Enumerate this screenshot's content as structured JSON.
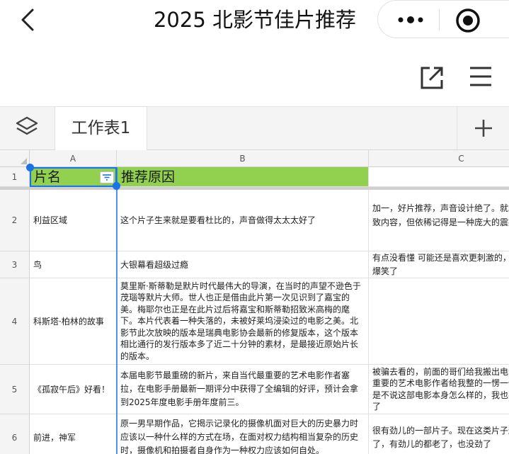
{
  "window": {
    "title": "2025 北影节佳片推荐",
    "back_icon": "chevron-left-icon",
    "more_icon": "more-dots-icon",
    "close_icon": "target-circle-icon"
  },
  "toolbar": {
    "share_icon": "share-external-icon",
    "menu_icon": "hamburger-menu-icon"
  },
  "sheets": {
    "layers_icon": "layers-icon",
    "active_tab": "工作表1",
    "add_icon": "plus-icon"
  },
  "grid": {
    "columns": [
      "A",
      "B",
      "C"
    ],
    "header_row": {
      "row": "1",
      "a": "片名",
      "b": "推荐原因",
      "c": ""
    },
    "header_fill": "#92d050",
    "rows": [
      {
        "row": "2",
        "a": "利益区域",
        "b": "这个片子生来就是要看杜比的，声音做得太太太好了",
        "c": "加一，好片推荐，声音设计绝了。就算忘记大致内容，但依稀记得是一种庞大的震撼"
      },
      {
        "row": "3",
        "a": "鸟",
        "b": "大银幕看超级过瘾",
        "c": "有点没看懂 可能还是喜欢更刺激的，但卫衣很爆笑了"
      },
      {
        "row": "4",
        "a": "科斯塔·柏林的故事",
        "b": "莫里斯·斯蒂勒是默片时代最伟大的导演，在当时的声望不逊色于茂瑙等默片大师。世人也正是借由此片第一次见识到了嘉宝的美。梅耶尔也正是在此片过后将嘉宝和斯蒂勒招致米高梅的麾下。本片代表着一种失落的，未被好莱坞浸染过的电影之美。北影节此次放映的版本是瑞典电影协会最新的修复版本，这个版本相比通行的发行版本多了近二十分钟的素材，是最接近原始片长的版本。",
        "c": ""
      },
      {
        "row": "5",
        "a": "《孤寂午后》好看！",
        "b": "本届电影节最重磅的新片，来自当代最重要的艺术电影作者塞拉，在电影手册最新一期评分中获得了全编辑的好评，预计会拿到2025年度电影手册年度前三。",
        "c": "被骗去看的，前面的哥们给我搬出电影节和最重要的艺术电影作者给我整的一愣一愣的，就是不说这部电影本身怎么样的，我也不会相信了"
      },
      {
        "row": "6",
        "a": "前进，神军",
        "b": "原一男早期作品，它揭示记录化的摄像机面对巨大的历史暴力时应该以一种什么样的方式在场，在面对权力结构相当复杂的历史时，摄像机和拍摄者自身作为一种权力应该如何自处。",
        "c": "很有劲儿的一部片子。现在这类片子越来越少了，有劲儿的都老了，也没劲了"
      }
    ]
  }
}
